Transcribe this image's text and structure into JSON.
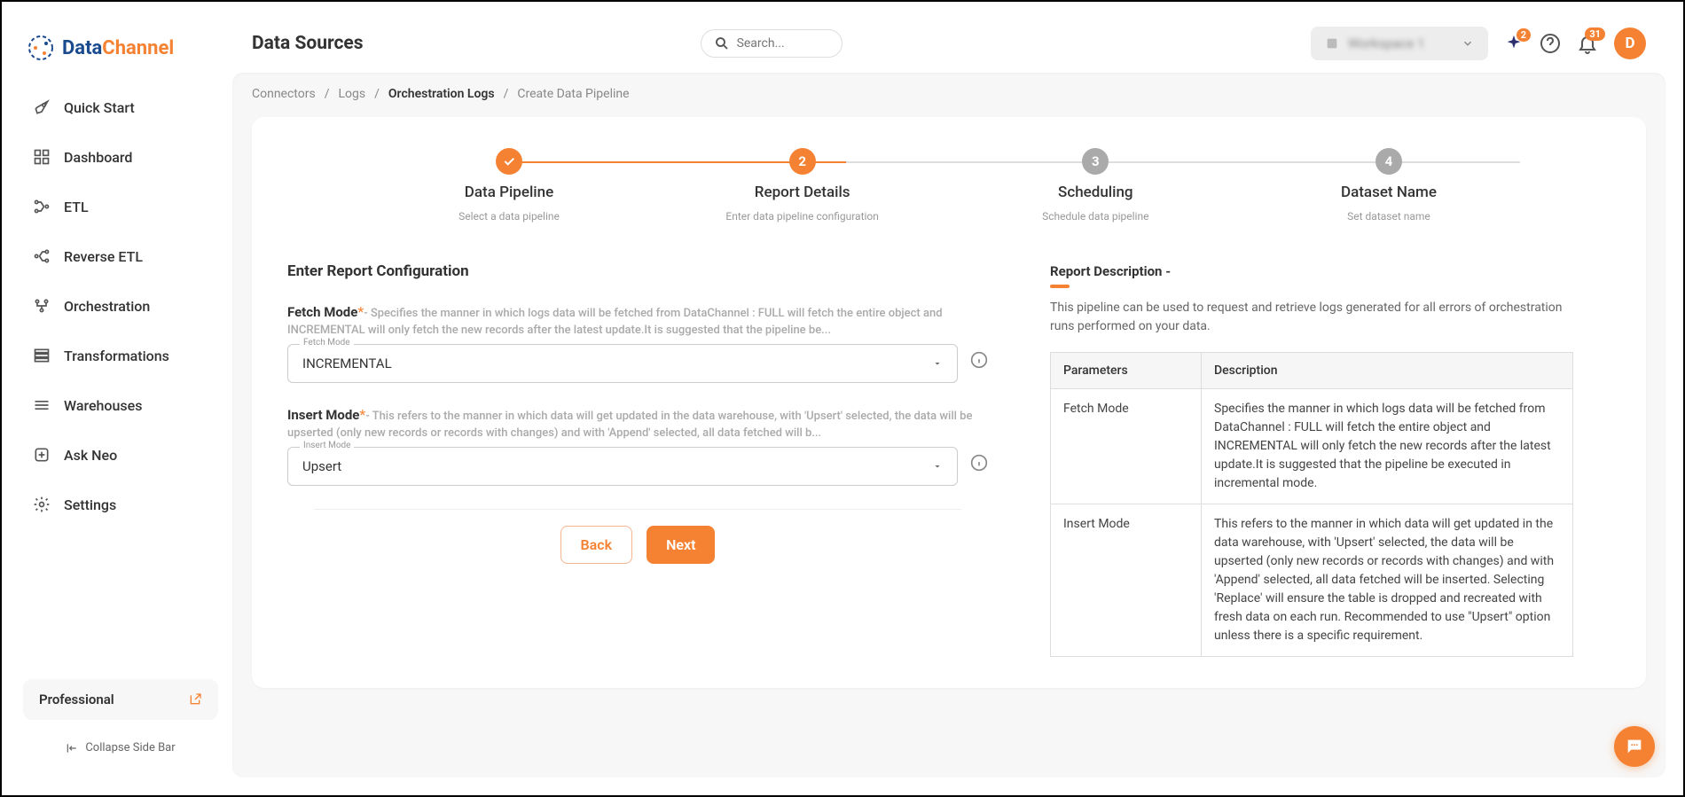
{
  "logo": {
    "text1": "Data",
    "text2": "Channel"
  },
  "nav": {
    "items": [
      {
        "label": "Quick Start"
      },
      {
        "label": "Dashboard"
      },
      {
        "label": "ETL"
      },
      {
        "label": "Reverse ETL"
      },
      {
        "label": "Orchestration"
      },
      {
        "label": "Transformations"
      },
      {
        "label": "Warehouses"
      },
      {
        "label": "Ask Neo"
      },
      {
        "label": "Settings"
      }
    ]
  },
  "plan": {
    "label": "Professional"
  },
  "collapse": {
    "label": "Collapse Side Bar"
  },
  "topbar": {
    "title": "Data Sources",
    "search_placeholder": "Search...",
    "workspace": "Workspace 1",
    "sparkle_badge": "2",
    "bell_badge": "31",
    "avatar": "D"
  },
  "breadcrumb": {
    "items": [
      "Connectors",
      "Logs",
      "Orchestration Logs",
      "Create Data Pipeline"
    ],
    "sep": "/"
  },
  "stepper": {
    "steps": [
      {
        "num": "✓",
        "title": "Data Pipeline",
        "sub": "Select a data pipeline"
      },
      {
        "num": "2",
        "title": "Report Details",
        "sub": "Enter data pipeline configuration"
      },
      {
        "num": "3",
        "title": "Scheduling",
        "sub": "Schedule data pipeline"
      },
      {
        "num": "4",
        "title": "Dataset Name",
        "sub": "Set dataset name"
      }
    ]
  },
  "form": {
    "heading": "Enter Report Configuration",
    "fields": {
      "fetch_mode": {
        "label": "Fetch Mode",
        "star": "*",
        "hint": "- Specifies the manner in which logs data will be fetched from DataChannel : FULL will fetch the entire object and INCREMENTAL will only fetch the new records after the latest update.It is suggested that the pipeline be...",
        "select_label": "Fetch Mode",
        "value": "INCREMENTAL"
      },
      "insert_mode": {
        "label": "Insert Mode",
        "star": "*",
        "hint": "- This refers to the manner in which data will get updated in the data warehouse, with 'Upsert' selected, the data will be upserted (only new records or records with changes) and with 'Append' selected, all data fetched will b...",
        "select_label": "Insert Mode",
        "value": "Upsert"
      }
    },
    "back": "Back",
    "next": "Next"
  },
  "desc": {
    "heading": "Report Description -",
    "text": "This pipeline can be used to request and retrieve logs generated for all errors of orchestration runs performed on your data.",
    "table": {
      "headers": [
        "Parameters",
        "Description"
      ],
      "rows": [
        {
          "p": "Fetch Mode",
          "d": "Specifies the manner in which logs data will be fetched from DataChannel : FULL will fetch the entire object and INCREMENTAL will only fetch the new records after the latest update.It is suggested that the pipeline be executed in incremental mode."
        },
        {
          "p": "Insert Mode",
          "d": "This refers to the manner in which data will get updated in the data warehouse, with 'Upsert' selected, the data will be upserted (only new records or records with changes) and with 'Append' selected, all data fetched will be inserted. Selecting 'Replace' will ensure the table is dropped and recreated with fresh data on each run. Recommended to use \"Upsert\" option unless there is a specific requirement."
        }
      ]
    }
  }
}
